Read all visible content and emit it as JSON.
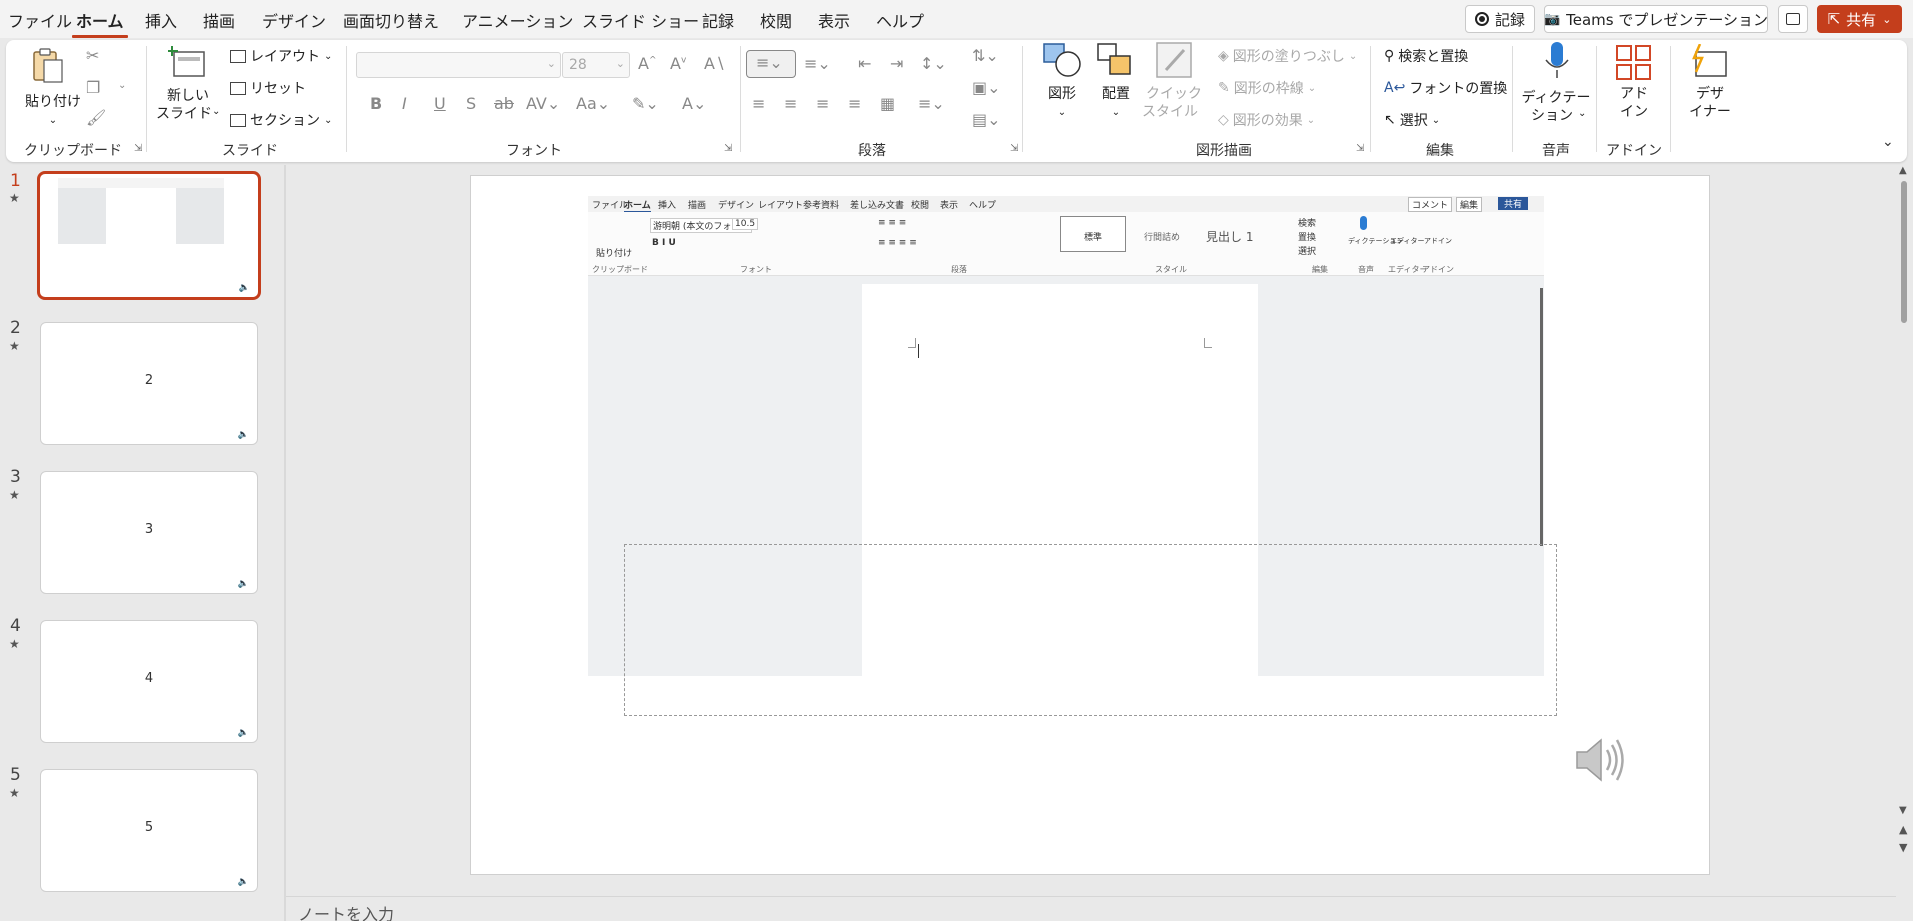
{
  "menu": {
    "tabs": [
      "ファイル",
      "ホーム",
      "挿入",
      "描画",
      "デザイン",
      "画面切り替え",
      "アニメーション",
      "スライド ショー",
      "記録",
      "校閲",
      "表示",
      "ヘルプ"
    ],
    "active": "ホーム",
    "record_label": "記録",
    "teams_label": "Teams でプレゼンテーション",
    "share_label": "共有"
  },
  "ribbon": {
    "groups": {
      "clipboard": "クリップボード",
      "slides": "スライド",
      "font": "フォント",
      "paragraph": "段落",
      "drawing": "図形描画",
      "editing": "編集",
      "voice": "音声",
      "addin": "アドイン"
    },
    "paste": "貼り付け",
    "new_slide_1": "新しい",
    "new_slide_2": "スライド",
    "layout": "レイアウト",
    "reset": "リセット",
    "section": "セクション",
    "font_size": "28",
    "shapes": "図形",
    "arrange": "配置",
    "quick_style_1": "クイック",
    "quick_style_2": "スタイル",
    "shape_fill": "図形の塗りつぶし",
    "shape_outline": "図形の枠線",
    "shape_effects": "図形の効果",
    "find_replace": "検索と置換",
    "font_replace": "フォントの置換",
    "select": "選択",
    "dictate_1": "ディクテー",
    "dictate_2": "ション",
    "addins_1": "アド",
    "addins_2": "イン",
    "designer_1": "デザ",
    "designer_2": "イナー"
  },
  "thumbnails": [
    {
      "num": "1",
      "label": ""
    },
    {
      "num": "2",
      "label": "2"
    },
    {
      "num": "3",
      "label": "3"
    },
    {
      "num": "4",
      "label": "4"
    },
    {
      "num": "5",
      "label": "5"
    }
  ],
  "inner": {
    "tabs": [
      "ファイル",
      "ホーム",
      "挿入",
      "描画",
      "デザイン",
      "レイアウト",
      "参考資料",
      "差し込み文書",
      "校閲",
      "表示",
      "ヘルプ"
    ],
    "comment": "コメント",
    "edit": "編集",
    "share": "共有",
    "font_name": "游明朝 (本文のフォント",
    "font_size": "10.5",
    "paste": "貼り付け",
    "style_normal": "標準",
    "style_nospace": "行間詰め",
    "style_h1": "見出し 1",
    "find": "検索",
    "replace": "置換",
    "select": "選択",
    "dictate": "ディクテーション",
    "editor": "エディター",
    "addin": "アドイン",
    "grp_clipboard": "クリップボード",
    "grp_font": "フォント",
    "grp_paragraph": "段落",
    "grp_style": "スタイル",
    "grp_edit": "編集",
    "grp_voice": "音声",
    "grp_editor": "エディター",
    "grp_addin": "アドイン"
  },
  "notes_placeholder": "ノートを入力",
  "colors": {
    "accent": "#c43e1c",
    "ribbon_bg": "#ffffff",
    "app_bg": "#e9e9e9",
    "word_blue": "#2b579a"
  }
}
